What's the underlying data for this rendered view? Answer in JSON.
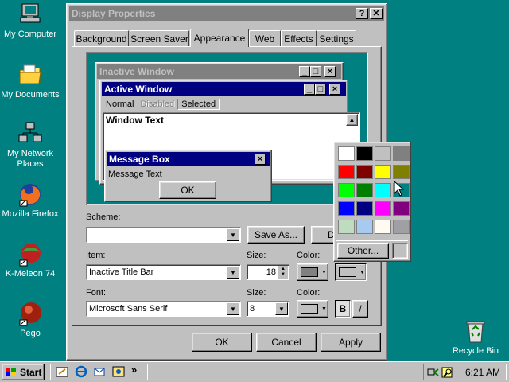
{
  "desktop": {
    "icons": [
      {
        "label": "My Computer",
        "icon": "computer-icon"
      },
      {
        "label": "My Documents",
        "icon": "folder-icon"
      },
      {
        "label": "My Network Places",
        "icon": "network-icon"
      },
      {
        "label": "Mozilla Firefox",
        "icon": "firefox-icon"
      },
      {
        "label": "K-Meleon 74",
        "icon": "kmeleon-icon"
      },
      {
        "label": "Pego",
        "icon": "pego-icon"
      },
      {
        "label": "Recycle Bin",
        "icon": "recycle-bin-icon"
      }
    ]
  },
  "window": {
    "title": "Display Properties",
    "help_button": "?",
    "close_button": "✕",
    "tabs": [
      "Background",
      "Screen Saver",
      "Appearance",
      "Web",
      "Effects",
      "Settings"
    ],
    "active_tab": "Appearance"
  },
  "preview": {
    "inactive_title": "Inactive Window",
    "active_title": "Active Window",
    "menu": [
      "Normal",
      "Disabled",
      "Selected"
    ],
    "window_text": "Window Text",
    "msgbox_title": "Message Box",
    "msgbox_text": "Message Text",
    "msgbox_ok": "OK"
  },
  "scheme": {
    "label": "Scheme:",
    "value": "",
    "save_as": "Save As...",
    "delete_partial": "D"
  },
  "item": {
    "label": "Item:",
    "value": "Inactive Title Bar",
    "size_label": "Size:",
    "size_value": "18",
    "color_label": "Color:"
  },
  "font": {
    "label": "Font:",
    "value": "Microsoft Sans Serif",
    "size_label": "Size:",
    "size_value": "8",
    "color_label": "Color:",
    "bold": "B",
    "italic": "/"
  },
  "buttons": {
    "ok": "OK",
    "cancel": "Cancel",
    "apply": "Apply"
  },
  "palette": {
    "colors": [
      "#ffffff",
      "#000000",
      "#c0c0c0",
      "#808080",
      "#ff0000",
      "#800000",
      "#ffff00",
      "#808000",
      "#00ff00",
      "#008000",
      "#00ffff",
      "#008080",
      "#0000ff",
      "#000080",
      "#ff00ff",
      "#800080",
      "#c0dcc0",
      "#a6caf0",
      "#fffbf0",
      "#a0a0a4"
    ],
    "other_label": "Other..."
  },
  "taskbar": {
    "start_label": "Start",
    "quicklaunch": [
      "show-desktop-icon",
      "ie-icon",
      "outlook-icon",
      "channels-icon"
    ],
    "overflow": "»",
    "clock": "6:21 AM"
  },
  "colors": {
    "desktop": "#008080",
    "active_title": "#000080",
    "inactive_title": "#808080"
  }
}
